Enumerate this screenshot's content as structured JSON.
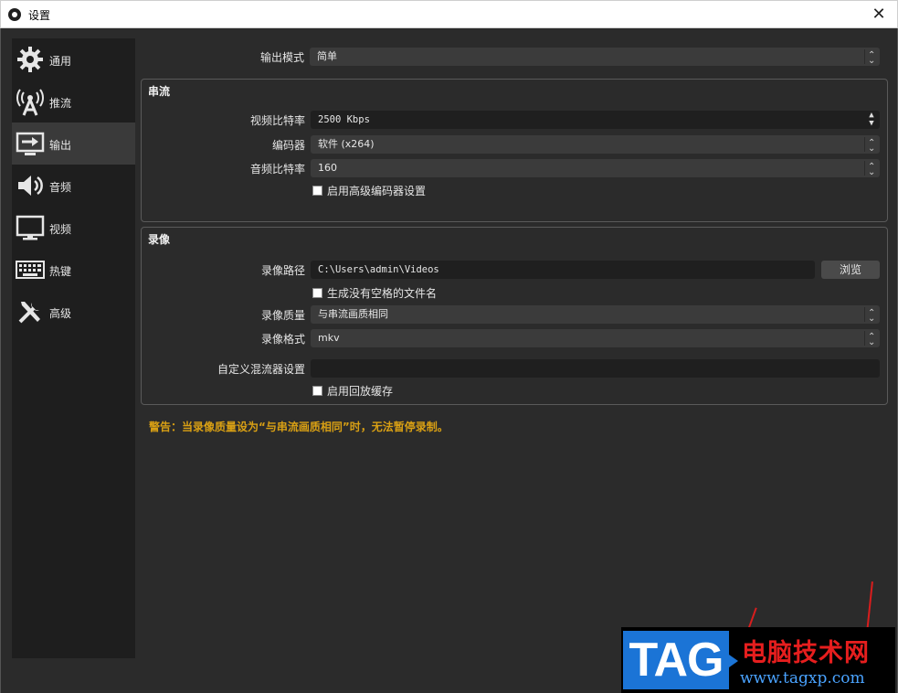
{
  "window": {
    "title": "设置",
    "close_glyph": "✕"
  },
  "sidebar": {
    "items": [
      {
        "label": "通用",
        "icon": "gear-icon"
      },
      {
        "label": "推流",
        "icon": "broadcast-antenna-icon"
      },
      {
        "label": "输出",
        "icon": "output-monitor-icon",
        "active": true
      },
      {
        "label": "音频",
        "icon": "speaker-icon"
      },
      {
        "label": "视频",
        "icon": "monitor-icon"
      },
      {
        "label": "热键",
        "icon": "keyboard-icon"
      },
      {
        "label": "高级",
        "icon": "tools-icon"
      }
    ]
  },
  "output_mode": {
    "label": "输出模式",
    "value": "简单"
  },
  "streaming": {
    "title": "串流",
    "video_bitrate": {
      "label": "视频比特率",
      "value": "2500 Kbps"
    },
    "encoder": {
      "label": "编码器",
      "value": "软件 (x264)"
    },
    "audio_bitrate": {
      "label": "音频比特率",
      "value": "160"
    },
    "advanced_encoder": {
      "label": "启用高级编码器设置",
      "checked": false
    }
  },
  "recording": {
    "title": "录像",
    "path": {
      "label": "录像路径",
      "value": "C:\\Users\\admin\\Videos",
      "browse": "浏览"
    },
    "no_space_filename": {
      "label": "生成没有空格的文件名",
      "checked": false
    },
    "quality": {
      "label": "录像质量",
      "value": "与串流画质相同"
    },
    "format": {
      "label": "录像格式",
      "value": "mkv"
    },
    "custom_muxer": {
      "label": "自定义混流器设置",
      "value": ""
    },
    "replay_buffer": {
      "label": "启用回放缓存",
      "checked": false
    }
  },
  "warning": "警告：当录像质量设为“与串流画质相同”时，无法暂停录制。",
  "watermark": {
    "tag": "TAG",
    "name": "电脑技术网",
    "url": "www.tagxp.com"
  },
  "colors": {
    "warning": "#d9a014",
    "sidebar_active": "#3a3a3a",
    "panel_bg": "#2b2b2b",
    "watermark_red": "#e61e1e",
    "watermark_blue": "#1b74d6"
  }
}
